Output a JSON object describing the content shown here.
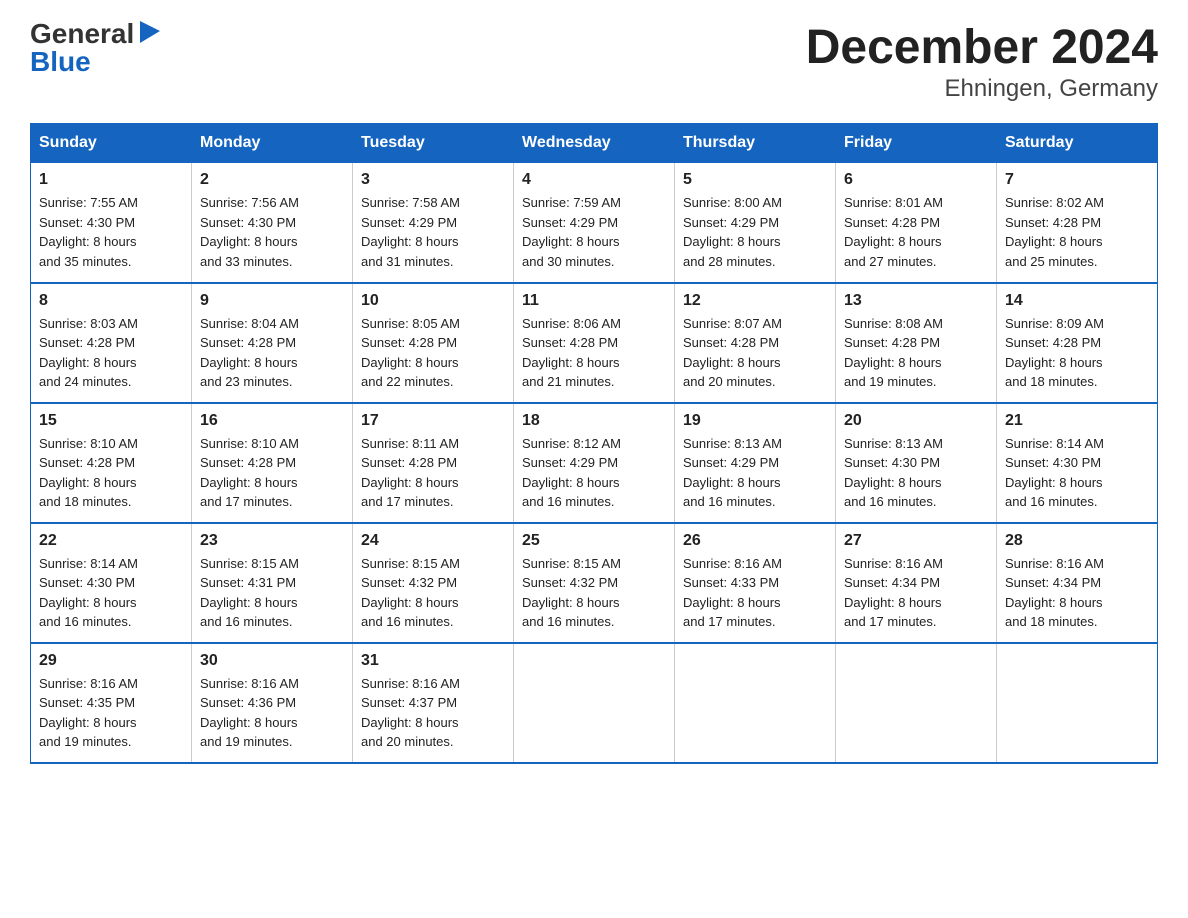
{
  "logo": {
    "general": "General",
    "blue": "Blue",
    "triangle": "▶"
  },
  "title": "December 2024",
  "subtitle": "Ehningen, Germany",
  "days_of_week": [
    "Sunday",
    "Monday",
    "Tuesday",
    "Wednesday",
    "Thursday",
    "Friday",
    "Saturday"
  ],
  "weeks": [
    [
      {
        "num": "1",
        "sunrise": "7:55 AM",
        "sunset": "4:30 PM",
        "daylight": "8 hours and 35 minutes."
      },
      {
        "num": "2",
        "sunrise": "7:56 AM",
        "sunset": "4:30 PM",
        "daylight": "8 hours and 33 minutes."
      },
      {
        "num": "3",
        "sunrise": "7:58 AM",
        "sunset": "4:29 PM",
        "daylight": "8 hours and 31 minutes."
      },
      {
        "num": "4",
        "sunrise": "7:59 AM",
        "sunset": "4:29 PM",
        "daylight": "8 hours and 30 minutes."
      },
      {
        "num": "5",
        "sunrise": "8:00 AM",
        "sunset": "4:29 PM",
        "daylight": "8 hours and 28 minutes."
      },
      {
        "num": "6",
        "sunrise": "8:01 AM",
        "sunset": "4:28 PM",
        "daylight": "8 hours and 27 minutes."
      },
      {
        "num": "7",
        "sunrise": "8:02 AM",
        "sunset": "4:28 PM",
        "daylight": "8 hours and 25 minutes."
      }
    ],
    [
      {
        "num": "8",
        "sunrise": "8:03 AM",
        "sunset": "4:28 PM",
        "daylight": "8 hours and 24 minutes."
      },
      {
        "num": "9",
        "sunrise": "8:04 AM",
        "sunset": "4:28 PM",
        "daylight": "8 hours and 23 minutes."
      },
      {
        "num": "10",
        "sunrise": "8:05 AM",
        "sunset": "4:28 PM",
        "daylight": "8 hours and 22 minutes."
      },
      {
        "num": "11",
        "sunrise": "8:06 AM",
        "sunset": "4:28 PM",
        "daylight": "8 hours and 21 minutes."
      },
      {
        "num": "12",
        "sunrise": "8:07 AM",
        "sunset": "4:28 PM",
        "daylight": "8 hours and 20 minutes."
      },
      {
        "num": "13",
        "sunrise": "8:08 AM",
        "sunset": "4:28 PM",
        "daylight": "8 hours and 19 minutes."
      },
      {
        "num": "14",
        "sunrise": "8:09 AM",
        "sunset": "4:28 PM",
        "daylight": "8 hours and 18 minutes."
      }
    ],
    [
      {
        "num": "15",
        "sunrise": "8:10 AM",
        "sunset": "4:28 PM",
        "daylight": "8 hours and 18 minutes."
      },
      {
        "num": "16",
        "sunrise": "8:10 AM",
        "sunset": "4:28 PM",
        "daylight": "8 hours and 17 minutes."
      },
      {
        "num": "17",
        "sunrise": "8:11 AM",
        "sunset": "4:28 PM",
        "daylight": "8 hours and 17 minutes."
      },
      {
        "num": "18",
        "sunrise": "8:12 AM",
        "sunset": "4:29 PM",
        "daylight": "8 hours and 16 minutes."
      },
      {
        "num": "19",
        "sunrise": "8:13 AM",
        "sunset": "4:29 PM",
        "daylight": "8 hours and 16 minutes."
      },
      {
        "num": "20",
        "sunrise": "8:13 AM",
        "sunset": "4:30 PM",
        "daylight": "8 hours and 16 minutes."
      },
      {
        "num": "21",
        "sunrise": "8:14 AM",
        "sunset": "4:30 PM",
        "daylight": "8 hours and 16 minutes."
      }
    ],
    [
      {
        "num": "22",
        "sunrise": "8:14 AM",
        "sunset": "4:30 PM",
        "daylight": "8 hours and 16 minutes."
      },
      {
        "num": "23",
        "sunrise": "8:15 AM",
        "sunset": "4:31 PM",
        "daylight": "8 hours and 16 minutes."
      },
      {
        "num": "24",
        "sunrise": "8:15 AM",
        "sunset": "4:32 PM",
        "daylight": "8 hours and 16 minutes."
      },
      {
        "num": "25",
        "sunrise": "8:15 AM",
        "sunset": "4:32 PM",
        "daylight": "8 hours and 16 minutes."
      },
      {
        "num": "26",
        "sunrise": "8:16 AM",
        "sunset": "4:33 PM",
        "daylight": "8 hours and 17 minutes."
      },
      {
        "num": "27",
        "sunrise": "8:16 AM",
        "sunset": "4:34 PM",
        "daylight": "8 hours and 17 minutes."
      },
      {
        "num": "28",
        "sunrise": "8:16 AM",
        "sunset": "4:34 PM",
        "daylight": "8 hours and 18 minutes."
      }
    ],
    [
      {
        "num": "29",
        "sunrise": "8:16 AM",
        "sunset": "4:35 PM",
        "daylight": "8 hours and 19 minutes."
      },
      {
        "num": "30",
        "sunrise": "8:16 AM",
        "sunset": "4:36 PM",
        "daylight": "8 hours and 19 minutes."
      },
      {
        "num": "31",
        "sunrise": "8:16 AM",
        "sunset": "4:37 PM",
        "daylight": "8 hours and 20 minutes."
      },
      null,
      null,
      null,
      null
    ]
  ],
  "labels": {
    "sunrise": "Sunrise:",
    "sunset": "Sunset:",
    "daylight": "Daylight:"
  }
}
